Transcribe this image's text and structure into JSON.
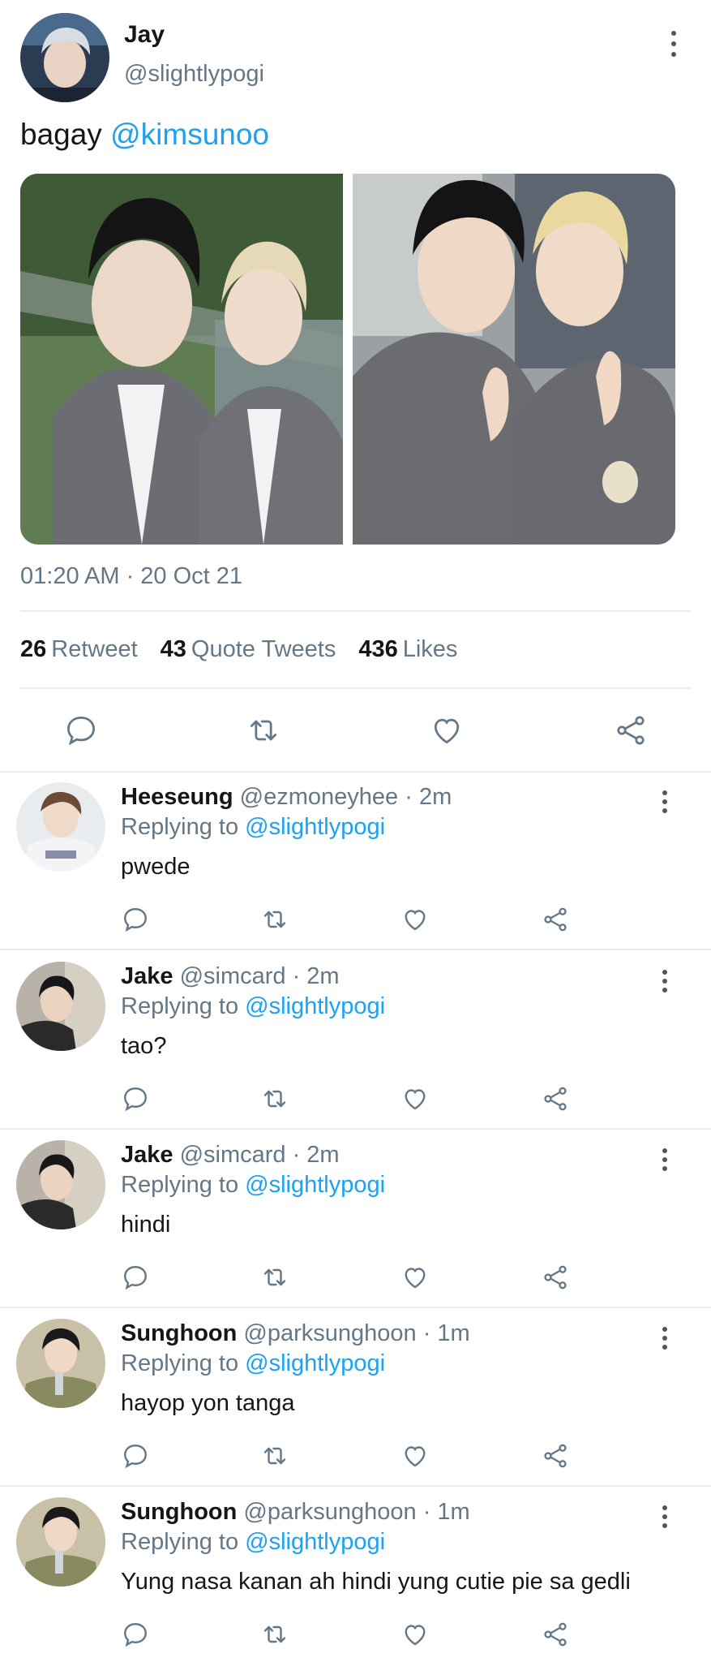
{
  "tweet": {
    "author_name": "Jay",
    "author_handle": "@slightlypogi",
    "text": "bagay",
    "mention": "@kimsunoo",
    "timestamp": "01:20 AM · 20 Oct 21",
    "stats": {
      "retweets_count": "26",
      "retweets_label": "Retweet",
      "quotes_count": "43",
      "quotes_label": "Quote Tweets",
      "likes_count": "436",
      "likes_label": "Likes"
    },
    "actions": [
      "comment-icon",
      "retweet-icon",
      "like-icon",
      "share-icon"
    ]
  },
  "replies": [
    {
      "name": "Heeseung",
      "meta": "@ezmoneyhee · 2m",
      "replying_label": "Replying to",
      "replying_to": "@slightlypogi",
      "text": "pwede"
    },
    {
      "name": "Jake",
      "meta": "@simcard · 2m",
      "replying_label": "Replying to",
      "replying_to": "@slightlypogi",
      "text": "tao?"
    },
    {
      "name": "Jake",
      "meta": "@simcard · 2m",
      "replying_label": "Replying to",
      "replying_to": "@slightlypogi",
      "text": "hindi"
    },
    {
      "name": "Sunghoon",
      "meta": "@parksunghoon · 1m",
      "replying_label": "Replying to",
      "replying_to": "@slightlypogi",
      "text": "hayop yon tanga"
    },
    {
      "name": "Sunghoon",
      "meta": "@parksunghoon · 1m",
      "replying_label": "Replying to",
      "replying_to": "@slightlypogi",
      "text": "Yung nasa kanan ah hindi yung cutie pie sa gedli"
    }
  ],
  "colors": {
    "accent": "#1da1f2",
    "secondary_text": "#657786",
    "divider": "#e6ecf0"
  }
}
